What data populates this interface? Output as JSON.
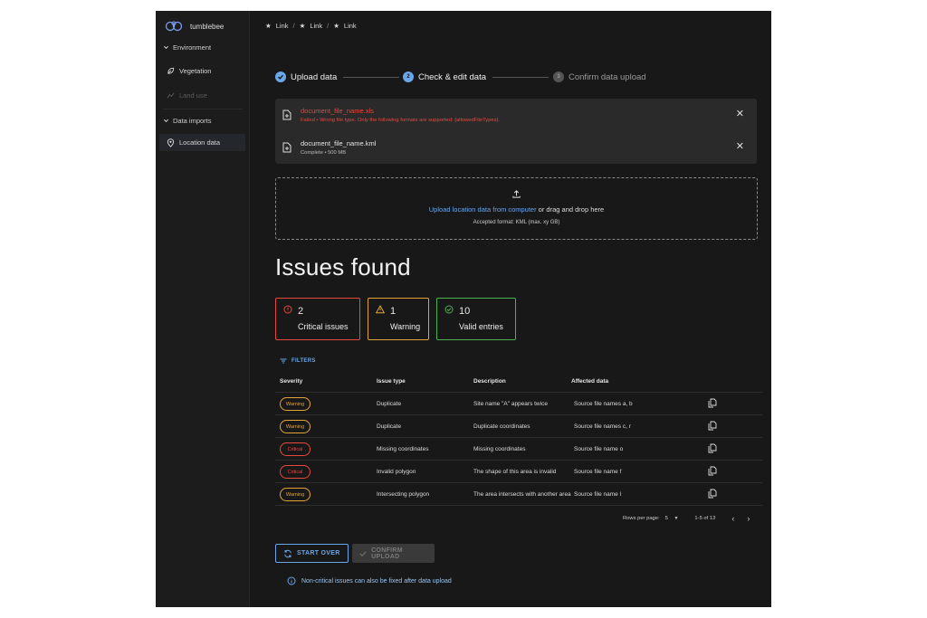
{
  "app": {
    "name": "tumblebee"
  },
  "sidebar": {
    "groups": [
      {
        "label": "Environment",
        "items": [
          {
            "label": "Vegetation",
            "state": "normal"
          },
          {
            "label": "Land use",
            "state": "disabled"
          }
        ]
      },
      {
        "label": "Data imports",
        "items": [
          {
            "label": "Location data",
            "state": "active"
          }
        ]
      }
    ]
  },
  "breadcrumb": [
    "Link",
    "Link",
    "Link"
  ],
  "stepper": {
    "steps": [
      {
        "label": "Upload data",
        "state": "complete"
      },
      {
        "label": "Check & edit data",
        "state": "current",
        "index": "2"
      },
      {
        "label": "Confirm data upload",
        "state": "pending",
        "index": "3"
      }
    ]
  },
  "files": [
    {
      "name": "document_file_name.xls",
      "status": "Failed",
      "detail": "Wrong file type. Only the following formats are supported: {allowedFileTypes}.",
      "state": "error"
    },
    {
      "name": "document_file_name.kml",
      "status": "Complete",
      "detail": "500 MB",
      "state": "ok"
    }
  ],
  "dropzone": {
    "link_text": "Upload location data from computer",
    "rest_text": " or drag and drop here",
    "accepted": "Accepted format: KML (max. xy GB)"
  },
  "issues": {
    "title": "Issues found",
    "cards": [
      {
        "count": "2",
        "label": "Critical issues",
        "color": "#e5483f"
      },
      {
        "count": "1",
        "label": "Warning",
        "color": "#e0a43a"
      },
      {
        "count": "10",
        "label": "Valid entries",
        "color": "#4caf50"
      }
    ]
  },
  "filters": {
    "label": "FILTERS"
  },
  "table": {
    "headers": [
      "Severity",
      "Issue type",
      "Description",
      "Affected data"
    ],
    "rows": [
      {
        "severity": "Warning",
        "type": "Duplicate",
        "description": "Site name \"A\" appears twice",
        "affected": "Source file names a, b"
      },
      {
        "severity": "Warning",
        "type": "Duplicate",
        "description": "Duplicate coordinates",
        "affected": "Source file names c, r"
      },
      {
        "severity": "Critical",
        "type": "Missing coordinates",
        "description": "Missing coordinates",
        "affected": "Source file name o"
      },
      {
        "severity": "Critical",
        "type": "Invalid polygon",
        "description": "The shape of this area is invalid",
        "affected": "Source file name f"
      },
      {
        "severity": "Warning",
        "type": "Intersecting polygon",
        "description": "The area intersects with another area",
        "affected": "Source file name l"
      }
    ]
  },
  "pagination": {
    "rows_label": "Rows per page:",
    "rows_value": "5",
    "range": "1-5 of 13"
  },
  "actions": {
    "start_over": "START OVER",
    "confirm": "CONFIRM UPLOAD"
  },
  "note": "Non-critical issues can also be fixed after data upload",
  "colors": {
    "accent": "#6aa6e8",
    "critical": "#e5483f",
    "warning": "#e0a43a",
    "valid": "#4caf50",
    "background": "#181818"
  }
}
